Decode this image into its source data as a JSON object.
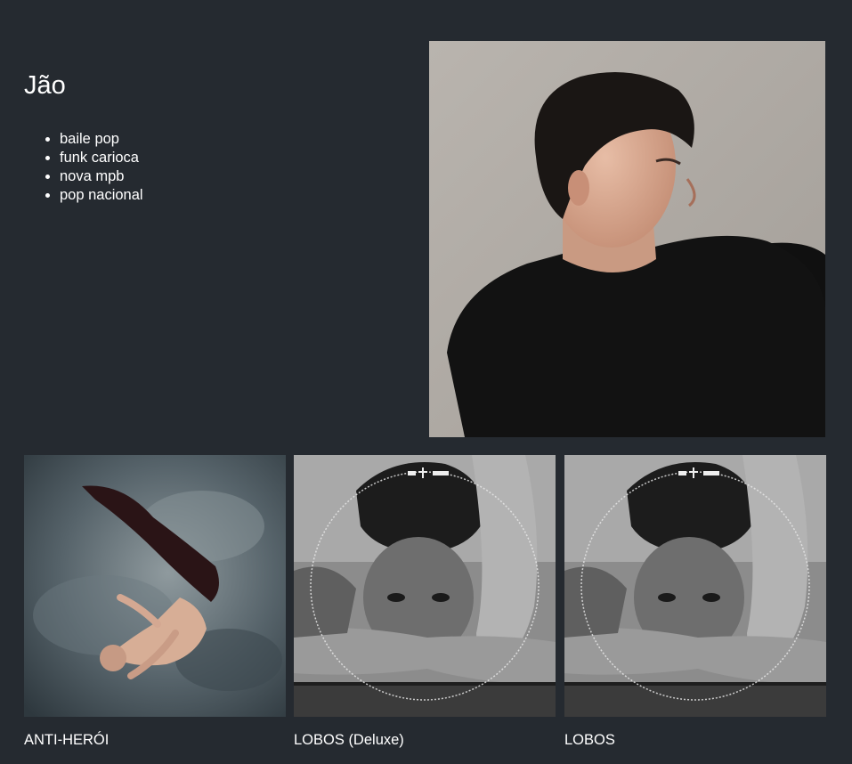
{
  "artist": {
    "name": "Jão",
    "genres": [
      "baile pop",
      "funk carioca",
      "nova mpb",
      "pop nacional"
    ]
  },
  "albums": [
    {
      "title": "ANTI-HERÓI"
    },
    {
      "title": "LOBOS (Deluxe)"
    },
    {
      "title": "LOBOS"
    }
  ],
  "colors": {
    "background": "#252a30",
    "text": "#ffffff"
  }
}
